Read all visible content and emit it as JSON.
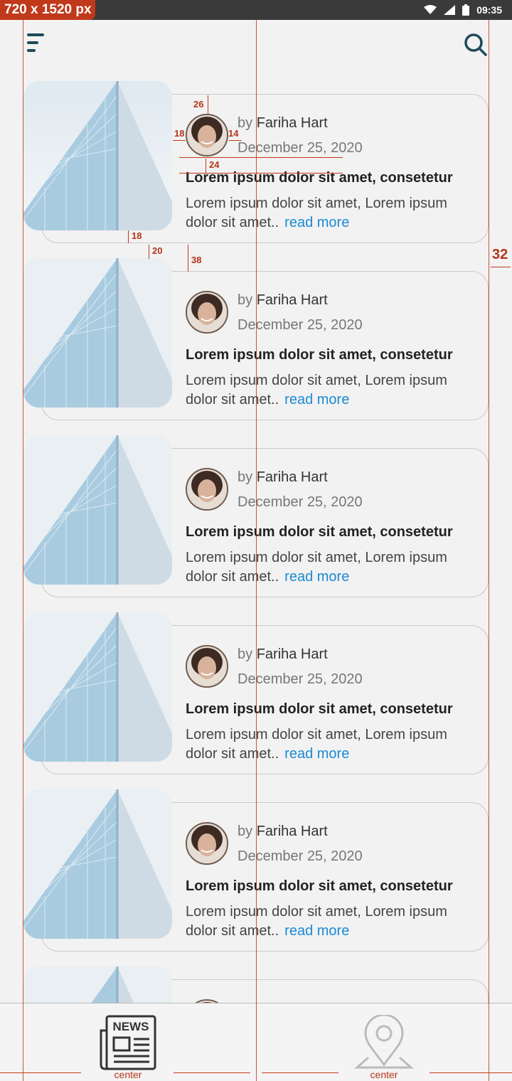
{
  "status_bar": {
    "size_badge": "720 x 1520 px",
    "time": "09:35",
    "icons": [
      "wifi-icon",
      "signal-icon",
      "battery-icon"
    ]
  },
  "header": {
    "menu_icon": "menu-icon",
    "search_icon": "search-icon"
  },
  "posts": [
    {
      "by": "by",
      "author": "Fariha Hart",
      "date": "December 25, 2020",
      "title": "Lorem ipsum dolor sit amet, consetetur",
      "excerpt": "Lorem ipsum dolor sit amet, Lorem ipsum dolor sit amet..",
      "read_more": "read more"
    },
    {
      "by": "by",
      "author": "Fariha Hart",
      "date": "December 25, 2020",
      "title": "Lorem ipsum dolor sit amet, consetetur",
      "excerpt": "Lorem ipsum dolor sit amet, Lorem ipsum dolor sit amet..",
      "read_more": "read more"
    },
    {
      "by": "by",
      "author": "Fariha Hart",
      "date": "December 25, 2020",
      "title": "Lorem ipsum dolor sit amet, consetetur",
      "excerpt": "Lorem ipsum dolor sit amet, Lorem ipsum dolor sit amet..",
      "read_more": "read more"
    },
    {
      "by": "by",
      "author": "Fariha Hart",
      "date": "December 25, 2020",
      "title": "Lorem ipsum dolor sit amet, consetetur",
      "excerpt": "Lorem ipsum dolor sit amet, Lorem ipsum dolor sit amet..",
      "read_more": "read more"
    },
    {
      "by": "by",
      "author": "Fariha Hart",
      "date": "December 25, 2020",
      "title": "Lorem ipsum dolor sit amet, consetetur",
      "excerpt": "Lorem ipsum dolor sit amet, Lorem ipsum dolor sit amet..",
      "read_more": "read more"
    }
  ],
  "bottom_nav": {
    "items": [
      {
        "icon": "newspaper-icon",
        "icon_text": "NEWS",
        "label": "center"
      },
      {
        "icon": "map-pin-icon",
        "label": "center"
      }
    ]
  },
  "annotations": {
    "avatar_top": "26",
    "avatar_left": "18",
    "avatar_right": "14",
    "title_gap": "24",
    "card_gap_1": "18",
    "card_gap_2": "20",
    "card_gap_3": "38",
    "right_margin": "32"
  },
  "colors": {
    "accent_link": "#1a8ad4",
    "header_icon": "#1e4a5c",
    "annotation": "#c0391b"
  }
}
